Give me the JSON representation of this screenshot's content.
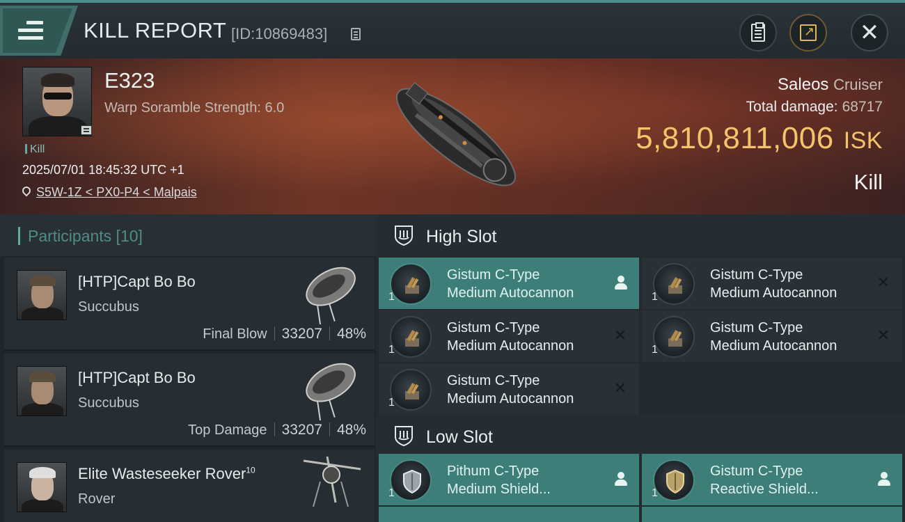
{
  "header": {
    "title": "KILL REPORT",
    "report_id": "[ID:10869483]"
  },
  "victim": {
    "name": "E323",
    "attribute": "Warp Soramble Strength: 6.0",
    "tag": "Kill",
    "datetime": "2025/07/01 18:45:32 UTC +1",
    "location": "S5W-1Z < PX0-P4 < Malpais",
    "ship": "Saleos",
    "ship_class": "Cruiser",
    "total_damage_label": "Total damage:",
    "total_damage": "68717",
    "isk_value": "5,810,811,006",
    "isk_unit": "ISK",
    "result": "Kill"
  },
  "participants": {
    "label": "Participants [10]",
    "items": [
      {
        "name": "[HTP]Capt Bo Bo",
        "level": "",
        "ship": "Succubus",
        "role": "Final Blow",
        "damage": "33207",
        "percent": "48%"
      },
      {
        "name": "[HTP]Capt Bo Bo",
        "level": "",
        "ship": "Succubus",
        "role": "Top Damage",
        "damage": "33207",
        "percent": "48%"
      },
      {
        "name": "Elite Wasteseeker Rover",
        "level": "10",
        "ship": "Rover",
        "role": "",
        "damage": "",
        "percent": ""
      }
    ]
  },
  "slots": {
    "high": {
      "label": "High Slot",
      "modules": [
        {
          "line1": "Gistum C-Type",
          "line2": "Medium Autocannon",
          "qty": "1"
        },
        {
          "line1": "Gistum C-Type",
          "line2": "Medium Autocannon",
          "qty": "1"
        },
        {
          "line1": "Gistum C-Type",
          "line2": "Medium Autocannon",
          "qty": "1"
        },
        {
          "line1": "Gistum C-Type",
          "line2": "Medium Autocannon",
          "qty": "1"
        },
        {
          "line1": "Gistum C-Type",
          "line2": "Medium Autocannon",
          "qty": "1"
        }
      ]
    },
    "low": {
      "label": "Low Slot",
      "modules": [
        {
          "line1": "Pithum C-Type",
          "line2": "Medium Shield...",
          "qty": "1"
        },
        {
          "line1": "Gistum C-Type",
          "line2": "Reactive Shield...",
          "qty": "1"
        }
      ]
    },
    "destroyed_mark": "✕"
  },
  "colors": {
    "accent_teal": "#3d7e79",
    "isk_gold": "#f3c46a",
    "share_gold": "#e3b45a"
  }
}
